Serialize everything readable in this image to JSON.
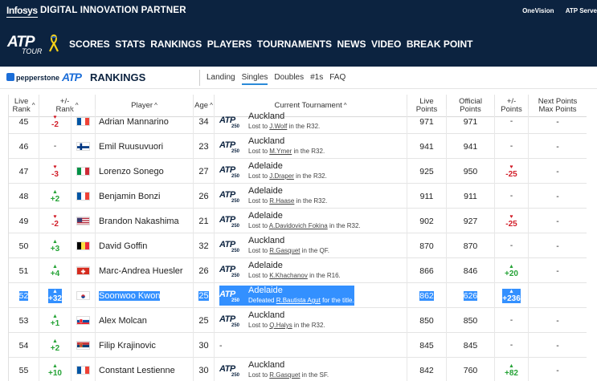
{
  "topbar": {
    "brand": "Infosys",
    "partner": "DIGITAL INNOVATION PARTNER",
    "links": [
      "OneVision",
      "ATP Serve"
    ]
  },
  "nav": {
    "logo_main": "ATP",
    "logo_sub": "TOUR",
    "items": [
      "SCORES",
      "STATS",
      "RANKINGS",
      "PLAYERS",
      "TOURNAMENTS",
      "NEWS",
      "VIDEO",
      "BREAK POINT"
    ]
  },
  "subnav": {
    "sponsor": "pepperstone",
    "atp": "ATP",
    "title": "RANKINGS",
    "links": [
      "Landing",
      "Singles",
      "Doubles",
      "#1s",
      "FAQ"
    ],
    "active": "Singles"
  },
  "table": {
    "headers": {
      "live_rank": [
        "Live",
        "Rank"
      ],
      "move": [
        "+/-",
        "Rank"
      ],
      "player": "Player",
      "age": "Age",
      "tournament": "Current Tournament",
      "live_points": [
        "Live",
        "Points"
      ],
      "official_points": [
        "Official",
        "Points"
      ],
      "pm_points": [
        "+/-",
        "Points"
      ],
      "next": [
        "Next Points",
        "Max Points"
      ]
    },
    "sort_glyph": "^",
    "tour_logo": "ATP",
    "tour_level": "250",
    "rows": [
      {
        "rank": "45",
        "move": "-2",
        "dir": "down",
        "flag": "FRA",
        "name": "Adrian Mannarino",
        "age": "34",
        "city": "Auckland",
        "res_pre": "Lost to ",
        "res_opp": "J.Wolf",
        "res_post": " in the R32.",
        "live": "971",
        "official": "971",
        "pm": "-",
        "pmdir": "none",
        "next": "-"
      },
      {
        "rank": "46",
        "move": "-",
        "dir": "none",
        "flag": "FIN",
        "name": "Emil Ruusuvuori",
        "age": "23",
        "city": "Auckland",
        "res_pre": "Lost to ",
        "res_opp": "M.Ymer",
        "res_post": " in the R32.",
        "live": "941",
        "official": "941",
        "pm": "-",
        "pmdir": "none",
        "next": "-"
      },
      {
        "rank": "47",
        "move": "-3",
        "dir": "down",
        "flag": "ITA",
        "name": "Lorenzo Sonego",
        "age": "27",
        "city": "Adelaide",
        "res_pre": "Lost to ",
        "res_opp": "J.Draper",
        "res_post": " in the R32.",
        "live": "925",
        "official": "950",
        "pm": "-25",
        "pmdir": "down",
        "next": "-"
      },
      {
        "rank": "48",
        "move": "+2",
        "dir": "up",
        "flag": "FRA",
        "name": "Benjamin Bonzi",
        "age": "26",
        "city": "Adelaide",
        "res_pre": "Lost to ",
        "res_opp": "R.Haase",
        "res_post": " in the R32.",
        "live": "911",
        "official": "911",
        "pm": "-",
        "pmdir": "none",
        "next": "-"
      },
      {
        "rank": "49",
        "move": "-2",
        "dir": "down",
        "flag": "USA",
        "name": "Brandon Nakashima",
        "age": "21",
        "city": "Adelaide",
        "res_pre": "Lost to ",
        "res_opp": "A.Davidovich Fokina",
        "res_post": " in the R32.",
        "live": "902",
        "official": "927",
        "pm": "-25",
        "pmdir": "down",
        "next": "-"
      },
      {
        "rank": "50",
        "move": "+3",
        "dir": "up",
        "flag": "BEL",
        "name": "David Goffin",
        "age": "32",
        "city": "Auckland",
        "res_pre": "Lost to ",
        "res_opp": "R.Gasquet",
        "res_post": " in the QF.",
        "live": "870",
        "official": "870",
        "pm": "-",
        "pmdir": "none",
        "next": "-"
      },
      {
        "rank": "51",
        "move": "+4",
        "dir": "up",
        "flag": "SUI",
        "name": "Marc-Andrea Huesler",
        "age": "26",
        "city": "Adelaide",
        "res_pre": "Lost to ",
        "res_opp": "K.Khachanov",
        "res_post": " in the R16.",
        "live": "866",
        "official": "846",
        "pm": "+20",
        "pmdir": "up",
        "next": "-"
      },
      {
        "rank": "52",
        "move": "+32",
        "dir": "up",
        "flag": "KOR",
        "name": "Soonwoo Kwon",
        "age": "25",
        "city": "Adelaide",
        "res_pre": "Defeated ",
        "res_opp": "R.Bautista Agut",
        "res_post": " for the title.",
        "live": "862",
        "official": "626",
        "pm": "+236",
        "pmdir": "up",
        "next": "",
        "selected": true
      },
      {
        "rank": "53",
        "move": "+1",
        "dir": "up",
        "flag": "SVK",
        "name": "Alex Molcan",
        "age": "25",
        "city": "Auckland",
        "res_pre": "Lost to ",
        "res_opp": "Q.Halys",
        "res_post": " in the R32.",
        "live": "850",
        "official": "850",
        "pm": "-",
        "pmdir": "none",
        "next": "-"
      },
      {
        "rank": "54",
        "move": "+2",
        "dir": "up",
        "flag": "SRB",
        "name": "Filip Krajinovic",
        "age": "30",
        "city": "",
        "res_pre": "",
        "res_opp": "",
        "res_post": "",
        "noTour": "-",
        "live": "845",
        "official": "845",
        "pm": "-",
        "pmdir": "none",
        "next": "-"
      },
      {
        "rank": "55",
        "move": "+10",
        "dir": "up",
        "flag": "FRA",
        "name": "Constant Lestienne",
        "age": "30",
        "city": "Auckland",
        "res_pre": "Lost to ",
        "res_opp": "R.Gasquet",
        "res_post": " in the SF.",
        "live": "842",
        "official": "760",
        "pm": "+82",
        "pmdir": "up",
        "next": "-"
      }
    ]
  },
  "colors": {
    "navy": "#0c2340",
    "up": "#25a336",
    "down": "#d21f2a",
    "selection": "#3390ff",
    "accent_blue": "#1c6ed8"
  }
}
